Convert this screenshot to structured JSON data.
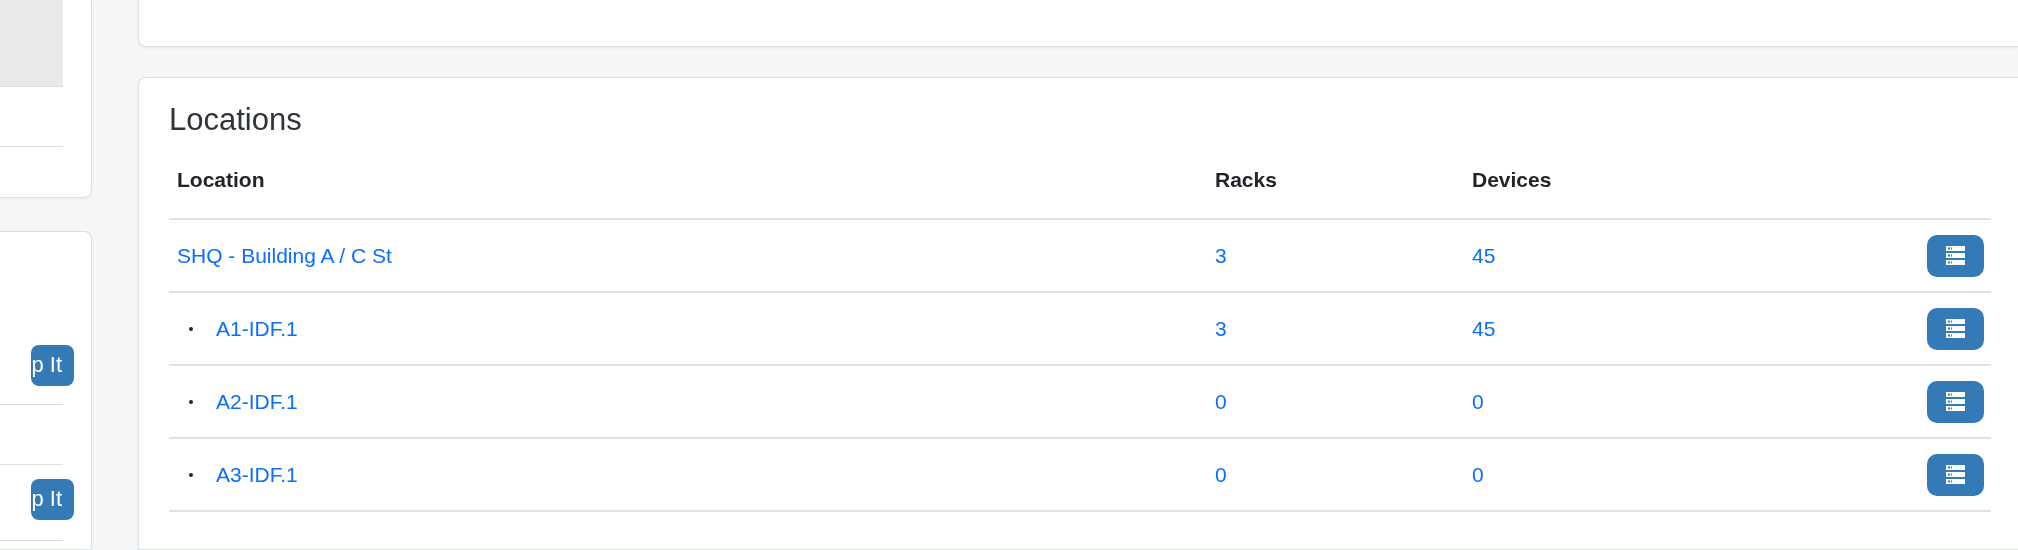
{
  "sidebar": {
    "buttons": [
      {
        "label": "p It"
      },
      {
        "label": "p It"
      }
    ]
  },
  "locations": {
    "title": "Locations",
    "columns": [
      "Location",
      "Racks",
      "Devices"
    ],
    "rows": [
      {
        "name": "SHQ - Building A / C St",
        "racks": "3",
        "devices": "45",
        "children": [
          {
            "name": "A1-IDF.1",
            "racks": "3",
            "devices": "45"
          },
          {
            "name": "A2-IDF.1",
            "racks": "0",
            "devices": "0"
          },
          {
            "name": "A3-IDF.1",
            "racks": "0",
            "devices": "0"
          }
        ]
      }
    ]
  }
}
